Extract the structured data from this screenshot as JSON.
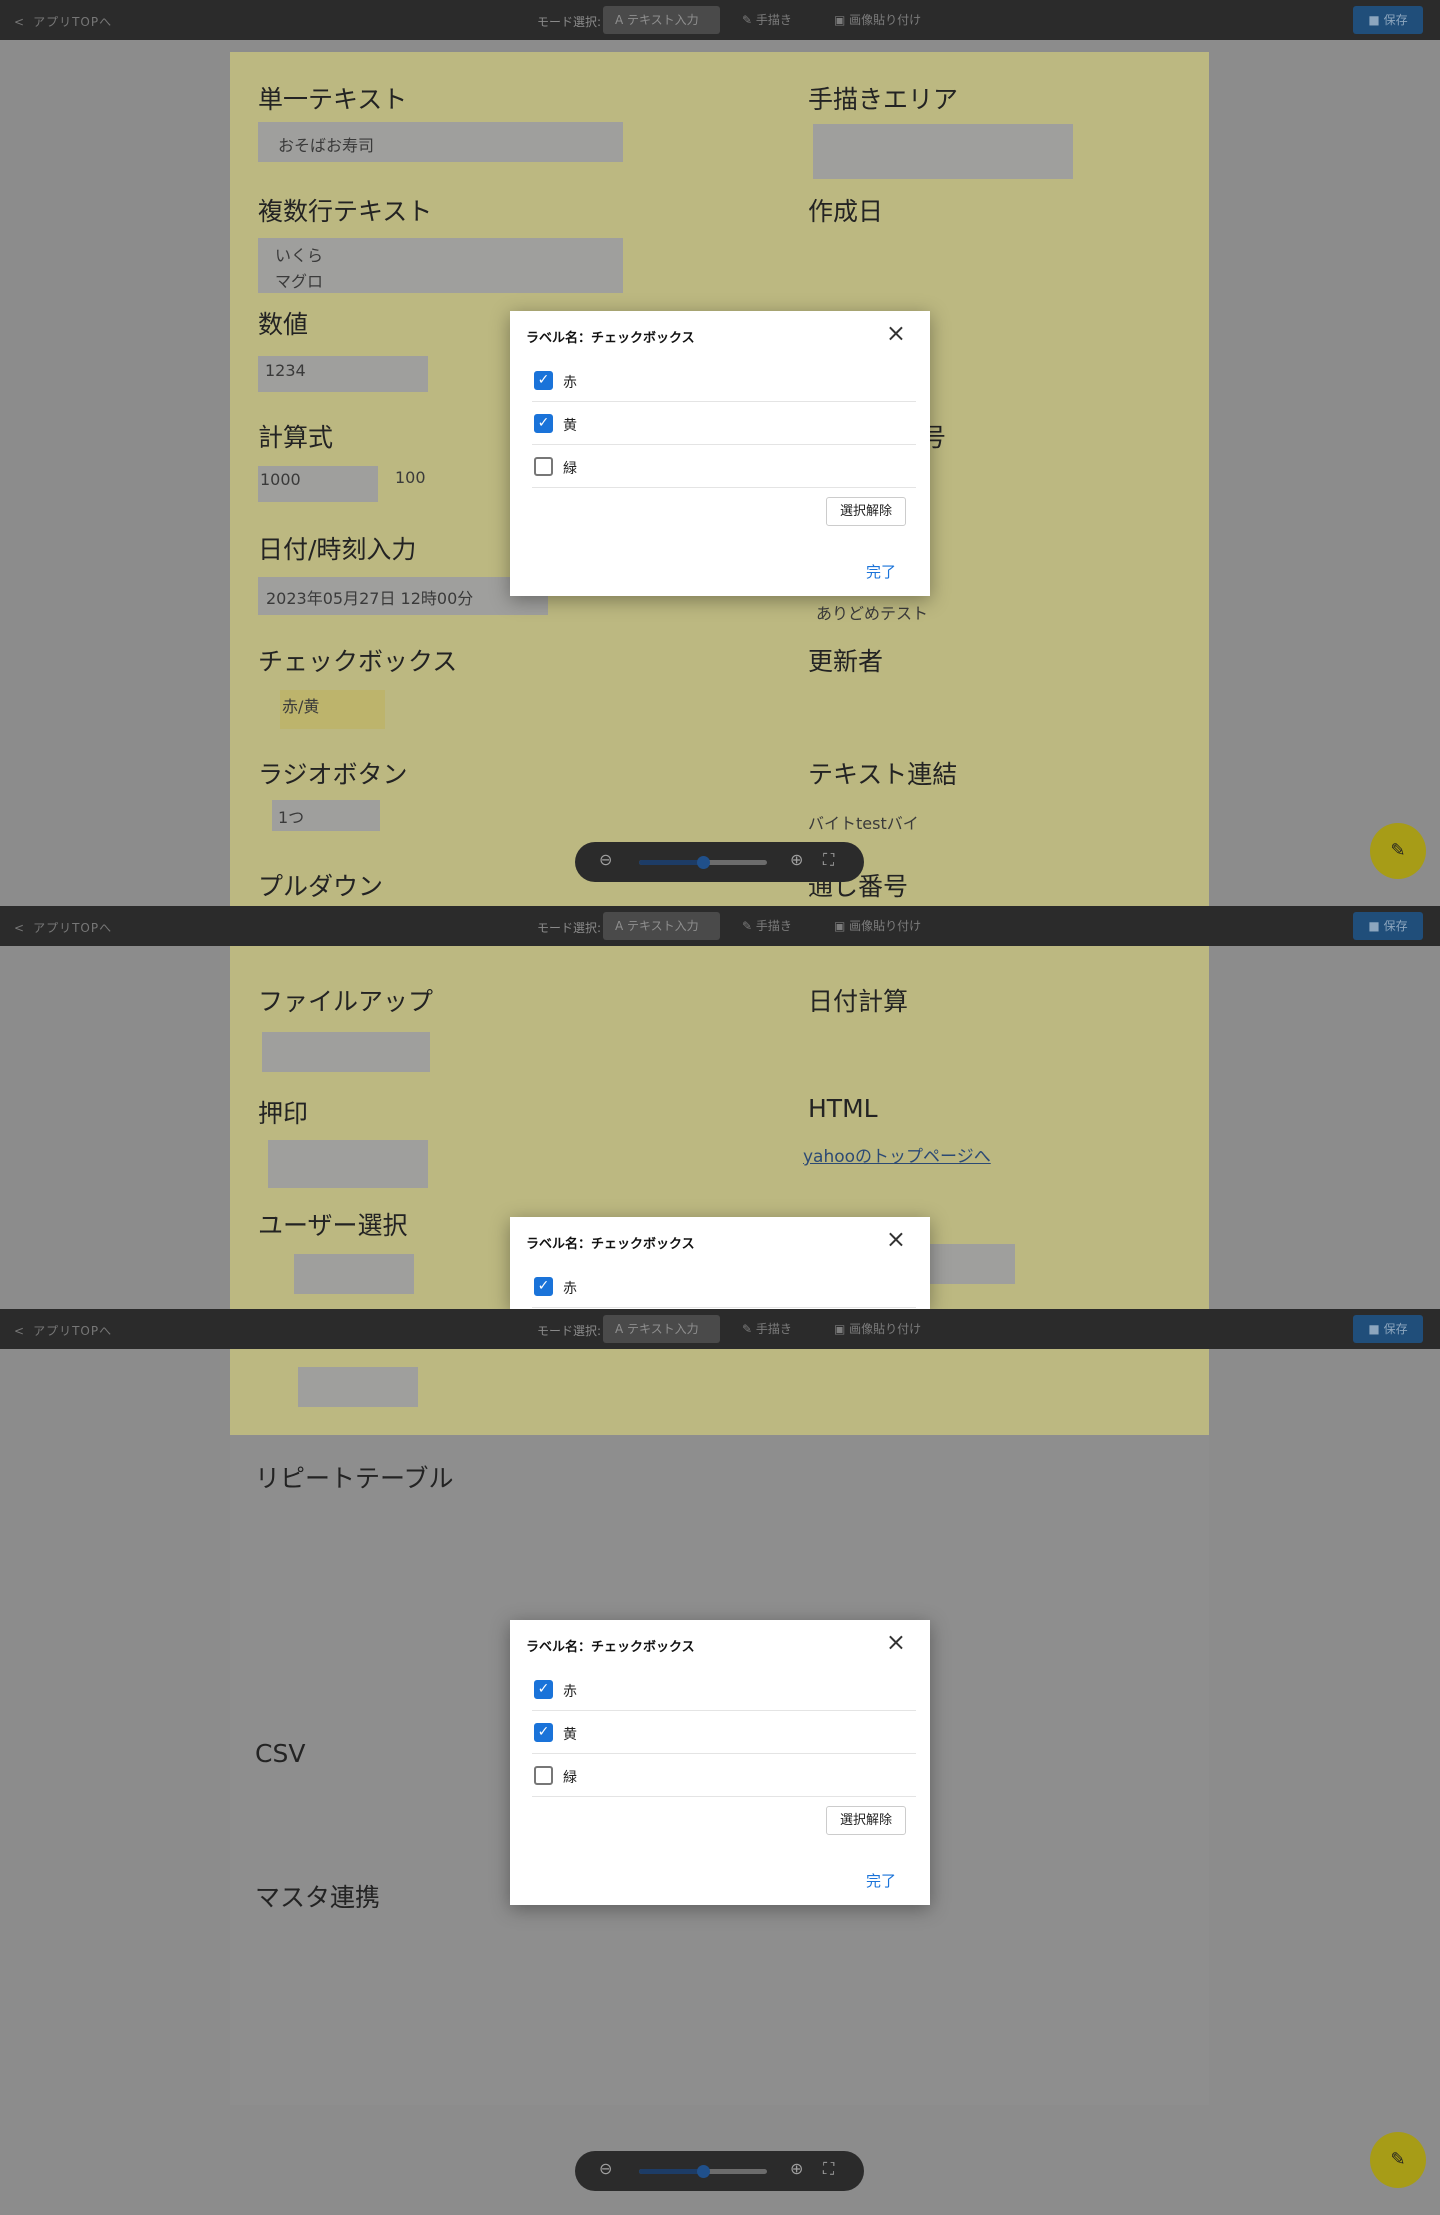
{
  "toolbar": {
    "back_label": "アプリTOPへ",
    "mode_label": "モード選択:",
    "modes": [
      "テキスト入力",
      "手描き",
      "画像貼り付け"
    ],
    "save_label": "保存"
  },
  "form": {
    "single_text": {
      "label": "単一テキスト",
      "value": "おそばお寿司"
    },
    "handwriting_area": {
      "label": "手描きエリア"
    },
    "multiline_text": {
      "label": "複数行テキスト",
      "lines": [
        "いくら",
        "マグロ"
      ]
    },
    "created_date": {
      "label": "作成日"
    },
    "number": {
      "label": "数値",
      "value": "1234"
    },
    "formula": {
      "label": "計算式",
      "value_a": "1000",
      "value_b": "100"
    },
    "number_partial_label": "号",
    "datetime": {
      "label": "日付/時刻入力",
      "value": "2023年05月27日 12時00分"
    },
    "creator_value": "ありどめテスト",
    "checkbox": {
      "label": "チェックボックス",
      "value": "赤/黄"
    },
    "updater": {
      "label": "更新者"
    },
    "radio": {
      "label": "ラジオボタン",
      "value": "1つ"
    },
    "text_concat": {
      "label": "テキスト連結",
      "value": "バイトtestバイ"
    },
    "dropdown": {
      "label": "プルダウン"
    },
    "serial_number": {
      "label": "通し番号"
    },
    "file_upload": {
      "label": "ファイルアップ"
    },
    "date_calc": {
      "label": "日付計算"
    },
    "stamp": {
      "label": "押印"
    },
    "html": {
      "label": "HTML",
      "link_text": "yahooのトップページへ"
    },
    "user_select": {
      "label": "ユーザー選択"
    },
    "repeat_table": {
      "label": "リピートテーブル"
    },
    "csv": {
      "label": "CSV"
    },
    "master_link": {
      "label": "マスタ連携"
    }
  },
  "modal": {
    "title": "ラベル名：チェックボックス",
    "options": [
      {
        "label": "赤",
        "checked": true
      },
      {
        "label": "黄",
        "checked": true
      },
      {
        "label": "緑",
        "checked": false
      }
    ],
    "clear_label": "選択解除",
    "done_label": "完了"
  },
  "zoom": {
    "level": 0.5
  },
  "colors": {
    "accent": "#1a73d9",
    "toolbar": "#2b2b2b",
    "form_bg": "#bcb881",
    "fab": "#a79c17"
  }
}
